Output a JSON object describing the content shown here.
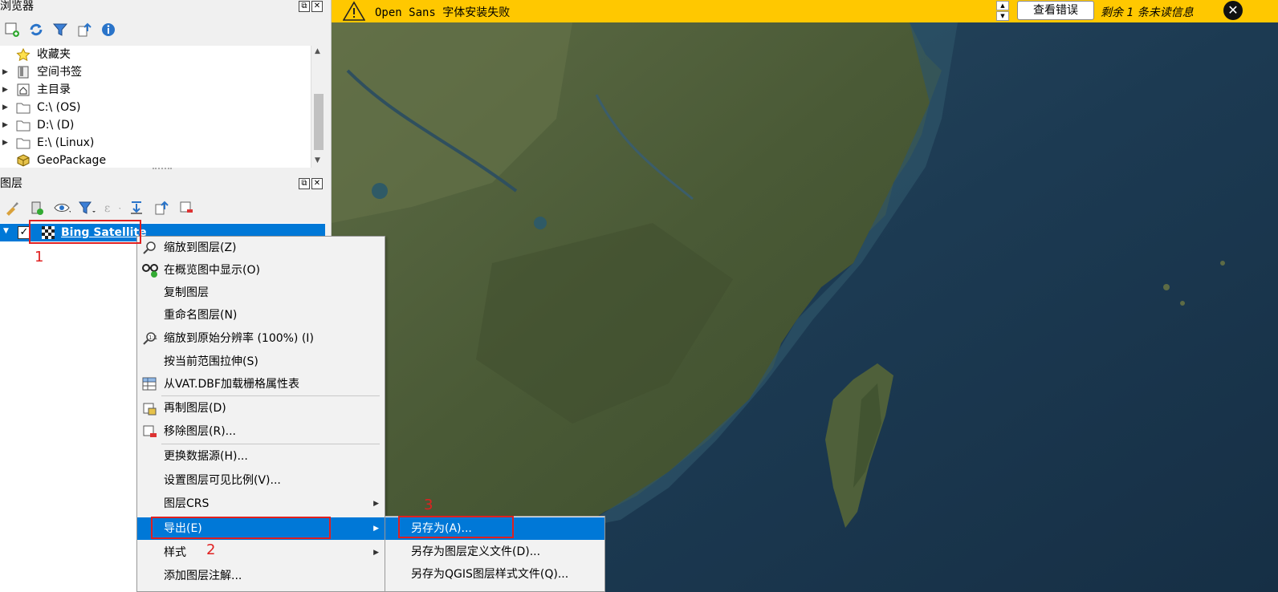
{
  "browser_panel": {
    "title": "浏览器",
    "items": [
      {
        "label": "收藏夹",
        "icon": "star-icon"
      },
      {
        "label": "空间书签",
        "icon": "bookmark-icon"
      },
      {
        "label": "主目录",
        "icon": "home-icon"
      },
      {
        "label": "C:\\ (OS)",
        "icon": "folder-icon"
      },
      {
        "label": "D:\\ (D)",
        "icon": "folder-icon"
      },
      {
        "label": "E:\\ (Linux)",
        "icon": "folder-icon"
      },
      {
        "label": "GeoPackage",
        "icon": "geopackage-icon"
      }
    ]
  },
  "layers_panel": {
    "title": "图层",
    "layer_name": "Bing Satellite"
  },
  "message_bar": {
    "text": "Open Sans 字体安装失败",
    "button": "查看错误",
    "count": "剩余 1 条未读信息"
  },
  "context_menu": {
    "items": [
      {
        "label": "缩放到图层(Z)",
        "icon": "zoom-layer-icon"
      },
      {
        "label": "在概览图中显示(O)",
        "icon": "overview-icon"
      },
      {
        "label": "复制图层"
      },
      {
        "label": "重命名图层(N)"
      },
      {
        "label": "缩放到原始分辨率 (100%) (I)",
        "icon": "zoom-native-icon"
      },
      {
        "label": "按当前范围拉伸(S)"
      },
      {
        "label": "从VAT.DBF加载栅格属性表",
        "icon": "table-icon"
      },
      {
        "label": "再制图层(D)",
        "icon": "duplicate-icon"
      },
      {
        "label": "移除图层(R)...",
        "icon": "remove-icon"
      },
      {
        "label": "更换数据源(H)..."
      },
      {
        "label": "设置图层可见比例(V)..."
      },
      {
        "label": "图层CRS"
      },
      {
        "label": "导出(E)"
      },
      {
        "label": "样式"
      },
      {
        "label": "添加图层注解..."
      }
    ]
  },
  "export_submenu": {
    "items": [
      {
        "label": "另存为(A)..."
      },
      {
        "label": "另存为图层定义文件(D)..."
      },
      {
        "label": "另存为QGIS图层样式文件(Q)..."
      }
    ]
  },
  "annotations": [
    "1",
    "2",
    "3"
  ]
}
